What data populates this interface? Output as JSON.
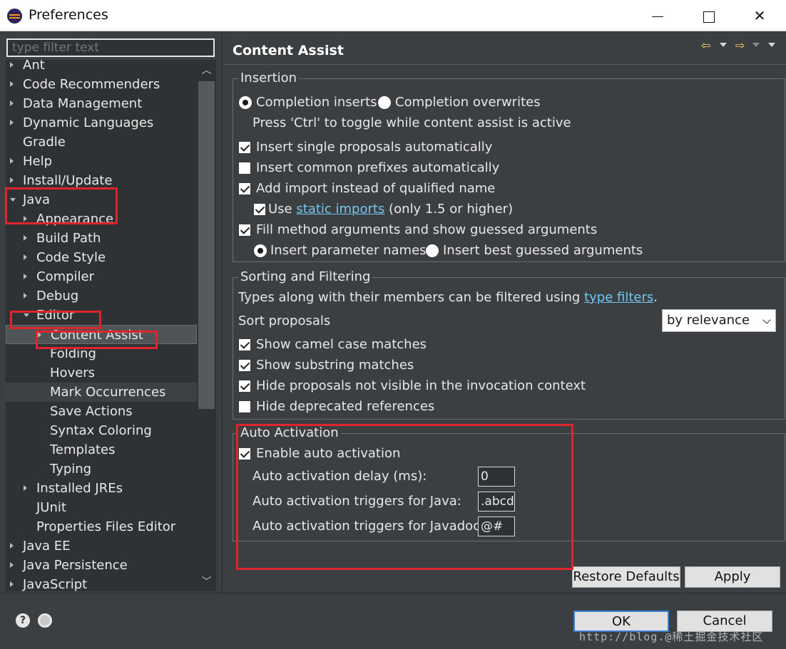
{
  "window": {
    "title": "Preferences",
    "minimize_icon": "minimize-icon",
    "maximize_icon": "maximize-icon",
    "close_glyph": "✕"
  },
  "filter": {
    "placeholder": "type filter text"
  },
  "tree": {
    "items": [
      {
        "label": "Ant",
        "twisty": "closed"
      },
      {
        "label": "Code Recommenders",
        "twisty": "closed"
      },
      {
        "label": "Data Management",
        "twisty": "closed"
      },
      {
        "label": "Dynamic Languages",
        "twisty": "closed"
      },
      {
        "label": "Gradle",
        "twisty": "none"
      },
      {
        "label": "Help",
        "twisty": "closed"
      },
      {
        "label": "Install/Update",
        "twisty": "closed"
      },
      {
        "label": "Java",
        "twisty": "open"
      },
      {
        "label": "Appearance",
        "twisty": "closed"
      },
      {
        "label": "Build Path",
        "twisty": "closed"
      },
      {
        "label": "Code Style",
        "twisty": "closed"
      },
      {
        "label": "Compiler",
        "twisty": "closed"
      },
      {
        "label": "Debug",
        "twisty": "closed"
      },
      {
        "label": "Editor",
        "twisty": "open"
      },
      {
        "label": "Content Assist",
        "twisty": "closed"
      },
      {
        "label": "Folding",
        "twisty": "none"
      },
      {
        "label": "Hovers",
        "twisty": "none"
      },
      {
        "label": "Mark Occurrences",
        "twisty": "none"
      },
      {
        "label": "Save Actions",
        "twisty": "none"
      },
      {
        "label": "Syntax Coloring",
        "twisty": "none"
      },
      {
        "label": "Templates",
        "twisty": "none"
      },
      {
        "label": "Typing",
        "twisty": "none"
      },
      {
        "label": "Installed JREs",
        "twisty": "closed"
      },
      {
        "label": "JUnit",
        "twisty": "none"
      },
      {
        "label": "Properties Files Editor",
        "twisty": "none"
      },
      {
        "label": "Java EE",
        "twisty": "closed"
      },
      {
        "label": "Java Persistence",
        "twisty": "closed"
      },
      {
        "label": "JavaScript",
        "twisty": "closed"
      }
    ],
    "scroll_up_glyph": "︿",
    "scroll_down_glyph": "﹀"
  },
  "page": {
    "title": "Content Assist",
    "nav": {
      "back_glyph": "⇦",
      "forward_glyph": "⇨"
    }
  },
  "insertion": {
    "label": "Insertion",
    "completion_inserts": "Completion inserts",
    "completion_overwrites": "Completion overwrites",
    "toggle_hint": "Press 'Ctrl' to toggle while content assist is active",
    "insert_single": "Insert single proposals automatically",
    "insert_common": "Insert common prefixes automatically",
    "add_import": "Add import instead of qualified name",
    "use_prefix": "Use",
    "static_imports": "static imports",
    "use_suffix": " (only 1.5 or higher)",
    "fill_args": "Fill method arguments and show guessed arguments",
    "insert_param_names": "Insert parameter names",
    "insert_best_guess": "Insert best guessed arguments"
  },
  "sorting": {
    "label": "Sorting and Filtering",
    "filter_text": "Types along with their members can be filtered using ",
    "type_filters": "type filters",
    "period": ".",
    "sort_label": "Sort proposals",
    "sort_value": "by relevance",
    "camel_case": "Show camel case matches",
    "substring": "Show substring matches",
    "hide_not_visible": "Hide proposals not visible in the invocation context",
    "hide_deprecated": "Hide deprecated references"
  },
  "auto_activation": {
    "label": "Auto Activation",
    "enable": "Enable auto activation",
    "delay_label": "Auto activation delay (ms):",
    "delay_value": "0",
    "java_label": "Auto activation triggers for Java:",
    "java_value": ".abcd",
    "javadoc_label": "Auto activation triggers for Javadoc:",
    "javadoc_value": "@#"
  },
  "buttons": {
    "restore_defaults": "Restore Defaults",
    "apply": "Apply",
    "ok": "OK",
    "cancel": "Cancel"
  },
  "footer": {
    "help_glyph": "?",
    "watermark": "http://blog.@稀土掘金技术社区"
  },
  "colors": {
    "background": "#3b3f42",
    "tree_background": "#2f3234",
    "link": "#74c7f0",
    "annotation": "#e0242b"
  }
}
